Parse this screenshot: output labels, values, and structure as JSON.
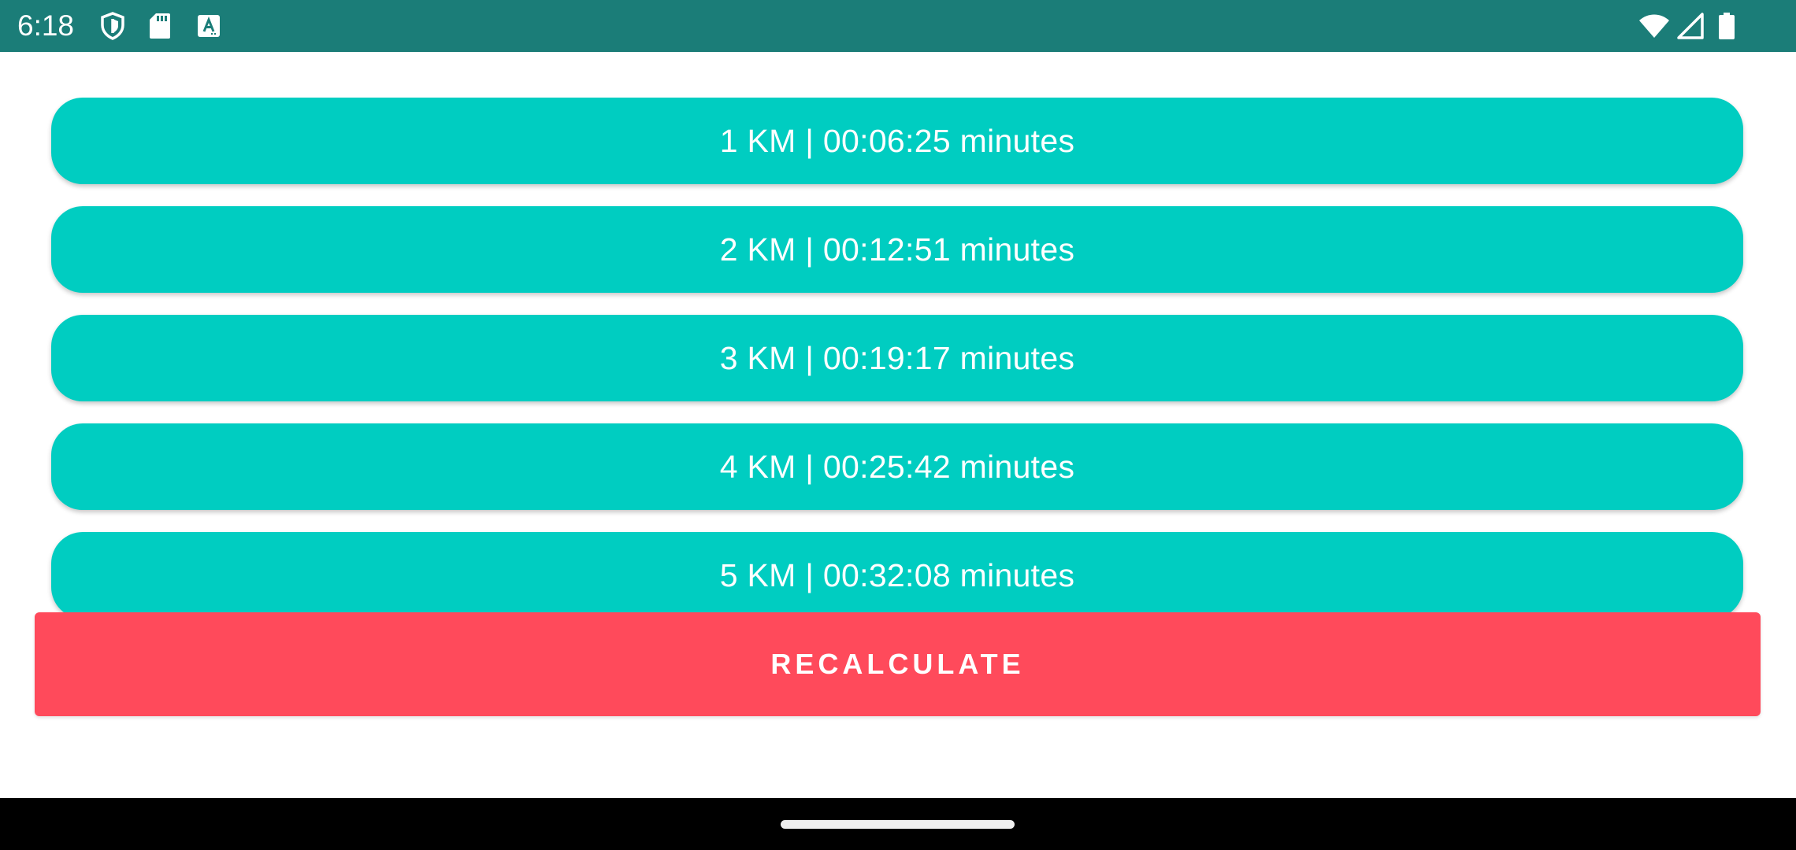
{
  "status_bar": {
    "time": "6:18",
    "left_icons": [
      "shield-icon",
      "sd-card-icon",
      "font-a-icon"
    ],
    "right_icons": [
      "wifi-icon",
      "signal-icon",
      "battery-icon"
    ],
    "background": "#1b7d78"
  },
  "splits": [
    {
      "label": "1 KM | 00:06:25 minutes"
    },
    {
      "label": "2 KM | 00:12:51 minutes"
    },
    {
      "label": "3 KM | 00:19:17 minutes"
    },
    {
      "label": "4 KM | 00:25:42 minutes"
    },
    {
      "label": "5 KM | 00:32:08 minutes"
    }
  ],
  "actions": {
    "recalculate_label": "RECALCULATE"
  },
  "colors": {
    "item_background": "#00cdc1",
    "button_background": "#ff4a5b"
  }
}
